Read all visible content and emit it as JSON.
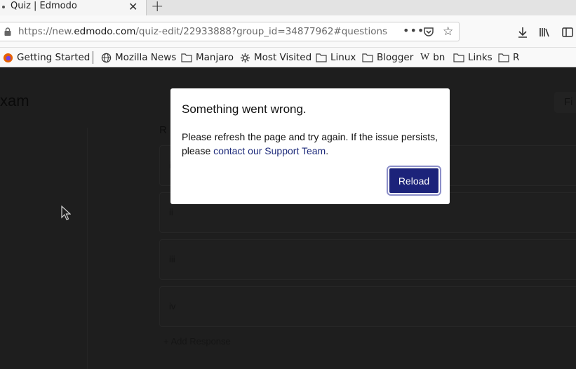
{
  "browser": {
    "tab": {
      "title": "Quiz | Edmodo",
      "close": "✕",
      "new_tab": "+"
    },
    "url": {
      "prefix": "https://new.",
      "domain": "edmodo.com",
      "path": "/quiz-edit/22933888?group_id=34877962#questions",
      "more": "•••"
    },
    "bookmarks": [
      {
        "label": "Getting Started",
        "icon": "firefox-icon"
      },
      {
        "label": "Mozilla News",
        "icon": "globe-icon"
      },
      {
        "label": "Manjaro",
        "icon": "folder-icon"
      },
      {
        "label": "Most Visited",
        "icon": "gear-icon"
      },
      {
        "label": "Linux",
        "icon": "folder-icon"
      },
      {
        "label": "Blogger",
        "icon": "folder-icon"
      },
      {
        "label": "bn",
        "icon": "wikipedia-icon"
      },
      {
        "label": "Links",
        "icon": "folder-icon"
      },
      {
        "label": "R",
        "icon": "folder-icon"
      }
    ]
  },
  "page": {
    "title": "xam",
    "top_button": "Fi",
    "responses_heading": "R",
    "responses": [
      "i",
      "ii",
      "iii",
      "iv"
    ],
    "add_response": "+ Add Response"
  },
  "modal": {
    "title": "Something went wrong.",
    "body_before": "Please refresh the page and try again. If the issue persists, please ",
    "link": "contact our Support Team",
    "body_after": ".",
    "button": "Reload"
  },
  "colors": {
    "modal_button": "#1c237a",
    "link": "#1d2a7a",
    "overlay": "#1e1e1e"
  }
}
